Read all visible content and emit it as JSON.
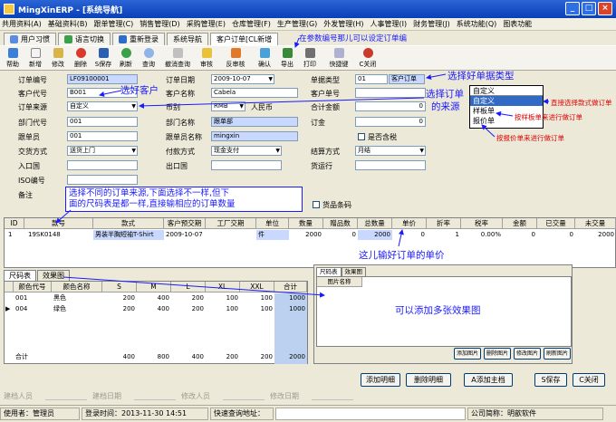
{
  "window": {
    "title": "MingXinERP - [系统导航]"
  },
  "menu": [
    "共用资料(A)",
    "基础资料(B)",
    "跟单管理(C)",
    "销售管理(D)",
    "采购管理(E)",
    "仓库管理(F)",
    "生产管理(G)",
    "外发管理(H)",
    "人事管理(I)",
    "财务管理(J)",
    "系统功能(Q)",
    "图表功能"
  ],
  "tabs": {
    "user": "用户习惯",
    "lang": "语言切换",
    "relogin": "重新登录",
    "nav": "系统导航",
    "order": "客户订单[CL新增"
  },
  "toolbar": [
    "帮助",
    "新增",
    "修改",
    "删除",
    "S保存",
    "刷新",
    "查询",
    "撤消查询",
    "审核",
    "反审核",
    "确认",
    "导出",
    "打印",
    "快捷键",
    "C关闭"
  ],
  "form": {
    "order_no_label": "订单编号",
    "order_no": "LF09100001",
    "order_date_label": "订单日期",
    "order_date": "2009-10-07",
    "doc_type_label": "单据类型",
    "doc_type_code": "01",
    "doc_type": "客户订单",
    "cust_code_label": "客户代号",
    "cust_code": "B001",
    "cust_name_label": "客户名称",
    "cust_name": "Cabela",
    "cust_ref_label": "客户单号",
    "source_label": "订单来源",
    "source": "自定义",
    "currency_label": "币别",
    "currency_code": "RMB",
    "currency": "人民币",
    "total_label": "合计金额",
    "total": "0",
    "dept_label": "部门代号",
    "dept_code": "001",
    "dept_name_label": "部门名称",
    "dept_name": "跟单部",
    "deposit_label": "订金",
    "deposit": "0",
    "staff_label": "跟单员",
    "staff_code": "001",
    "staff_name_label": "跟单员名称",
    "staff_name": "mingxin",
    "tax_label": "是否含税",
    "delivery_label": "交货方式",
    "delivery": "送货上门",
    "payment_label": "付款方式",
    "payment": "现金支付",
    "settle_label": "结算方式",
    "settle": "月结",
    "inport_label": "入口国",
    "export_label": "出口国",
    "shipper_label": "货运行",
    "iso_label": "ISO编号",
    "remark_label": "备注",
    "barcode_label": "货品条码",
    "dropdown_options": [
      "自定义",
      "样板单",
      "报价单"
    ]
  },
  "annotations": {
    "a1": "在参数编号那儿可以设定订单编",
    "a2": "选择好单据类型",
    "a3": "选好客户",
    "a4_1": "选择订单",
    "a4_2": "的来源",
    "a5": "直接选择款式做订单",
    "a6": "按样板单来进行做订单",
    "a7": "按报价单来进行做订单",
    "a8_1": "选择不同的订单来源,下面选择不一样,但下",
    "a8_2": "面的尺码表是都一样,直接输相应的订单数量",
    "a9": "这儿输好订单的单价",
    "a10": "可以添加多张效果图"
  },
  "grid1": {
    "headers": [
      "ID",
      "款号",
      "款式",
      "客户预交期",
      "工厂交期",
      "单位",
      "数量",
      "赠品数",
      "总数量",
      "单价",
      "折率",
      "税率",
      "金额",
      "已交量",
      "未交量"
    ],
    "row": [
      "1",
      "19SK0148",
      "男装半胸短袖T-Shirt",
      "2009-10-07",
      "",
      "件",
      "2000",
      "0",
      "2000",
      "0",
      "1",
      "0.00%",
      "0",
      "0",
      "2000"
    ]
  },
  "subtabs": [
    "尺码表",
    "效果图"
  ],
  "grid2": {
    "headers": [
      "颜色代号",
      "颜色名称",
      "S",
      "M",
      "L",
      "XL",
      "XXL",
      "合计"
    ],
    "rows": [
      [
        "001",
        "黑色",
        "200",
        "400",
        "200",
        "100",
        "100",
        "1000"
      ],
      [
        "004",
        "绿色",
        "200",
        "400",
        "200",
        "100",
        "100",
        "1000"
      ]
    ],
    "total_label": "合计",
    "totals": [
      "400",
      "800",
      "400",
      "200",
      "200",
      "2000"
    ]
  },
  "imgpanel": {
    "tabs": [
      "尺码表",
      "效果图"
    ],
    "col": "图片名称",
    "buttons": [
      "添加图片",
      "删除图片",
      "修改图片",
      "刷新图片"
    ]
  },
  "buttons": {
    "add_detail": "添加明细",
    "del_detail": "删除明细",
    "add_main": "A添加主档",
    "save": "S保存",
    "close": "C关闭"
  },
  "footer": {
    "creator": "建档人员",
    "create_date": "建档日期",
    "modifier": "修改人员",
    "modify_date": "修改日期"
  },
  "status": {
    "user": "使用者：管理员",
    "login": "登录时间：2013-11-30 14:51",
    "quick": "快速查询地址：",
    "company": "公司简称：明歆软件"
  },
  "colors": {
    "accent": "#1a1aff",
    "title": "#0a3fb8",
    "highlight": "#c8d8ff"
  }
}
